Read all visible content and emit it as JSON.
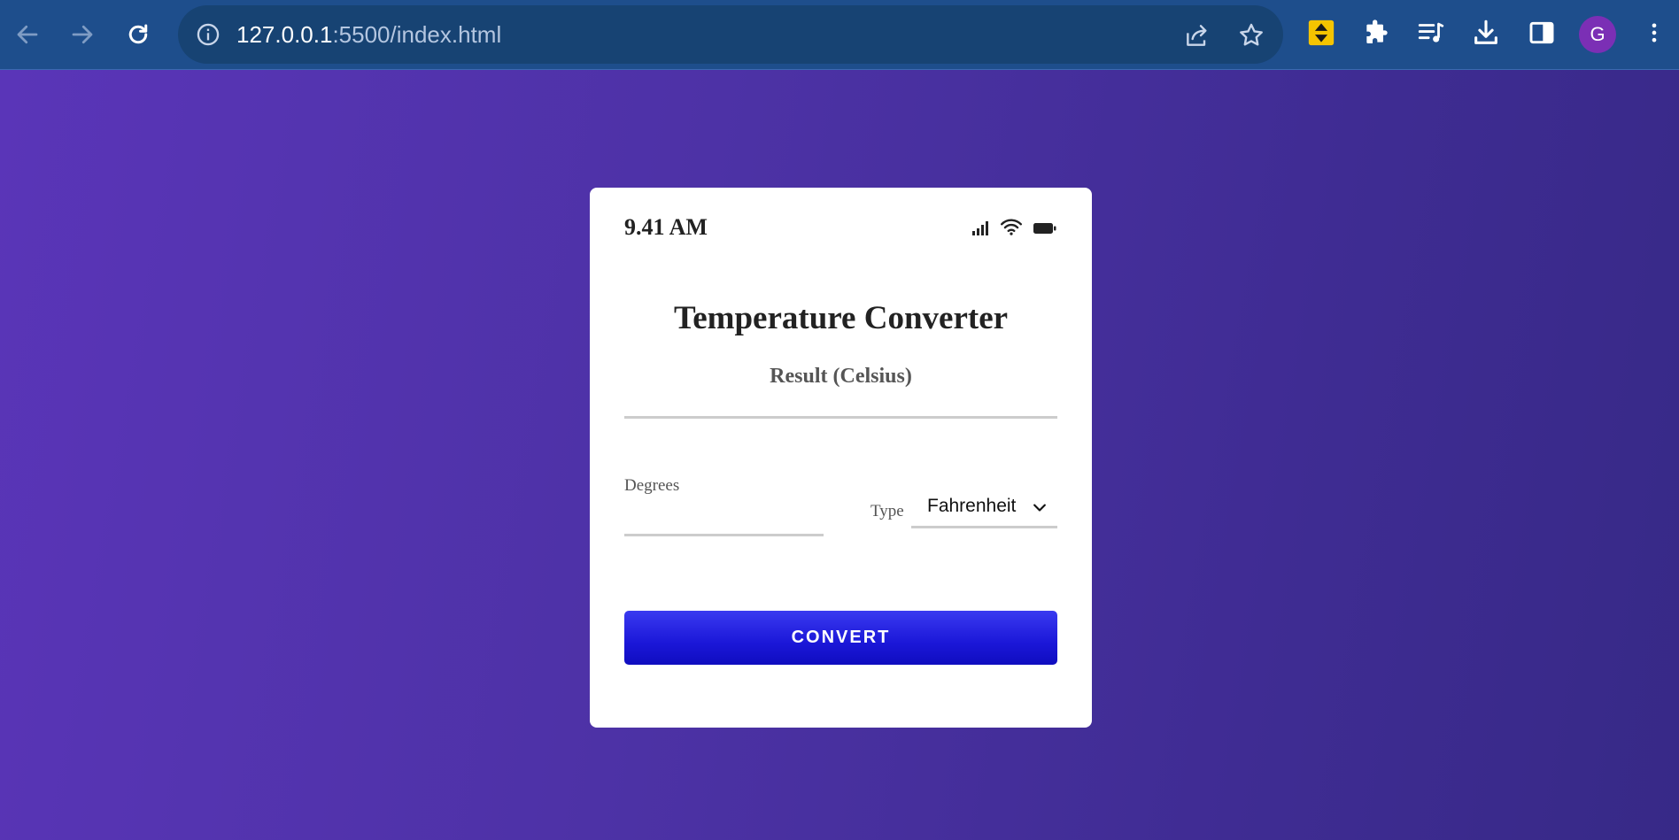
{
  "browser": {
    "url_host": "127.0.0.1",
    "url_rest": ":5500/index.html",
    "profile_initial": "G",
    "toolbar_color": "#1e4e8c"
  },
  "icons": {
    "back": "arrow-left-icon",
    "forward": "arrow-right-icon",
    "reload": "reload-icon",
    "site_info": "info-icon",
    "share": "share-icon",
    "bookmark": "star-icon",
    "extension_1": "extension-sort-icon",
    "extensions": "puzzle-icon",
    "media": "media-queue-icon",
    "download": "download-icon",
    "side_panel": "side-panel-icon",
    "menu": "kebab-menu-icon",
    "signal": "signal-icon",
    "wifi": "wifi-icon",
    "battery": "battery-icon",
    "dropdown": "chevron-down-icon"
  },
  "app": {
    "status_time": "9.41 AM",
    "title": "Temperature Converter",
    "result_label": "Result (Celsius)",
    "degrees_label": "Degrees",
    "degrees_value": "",
    "type_label": "Type",
    "type_selected": "Fahrenheit",
    "convert_label": "CONVERT",
    "accent_color": "#1b17d8",
    "background_gradient": [
      "#5a35b8",
      "#372987"
    ]
  }
}
